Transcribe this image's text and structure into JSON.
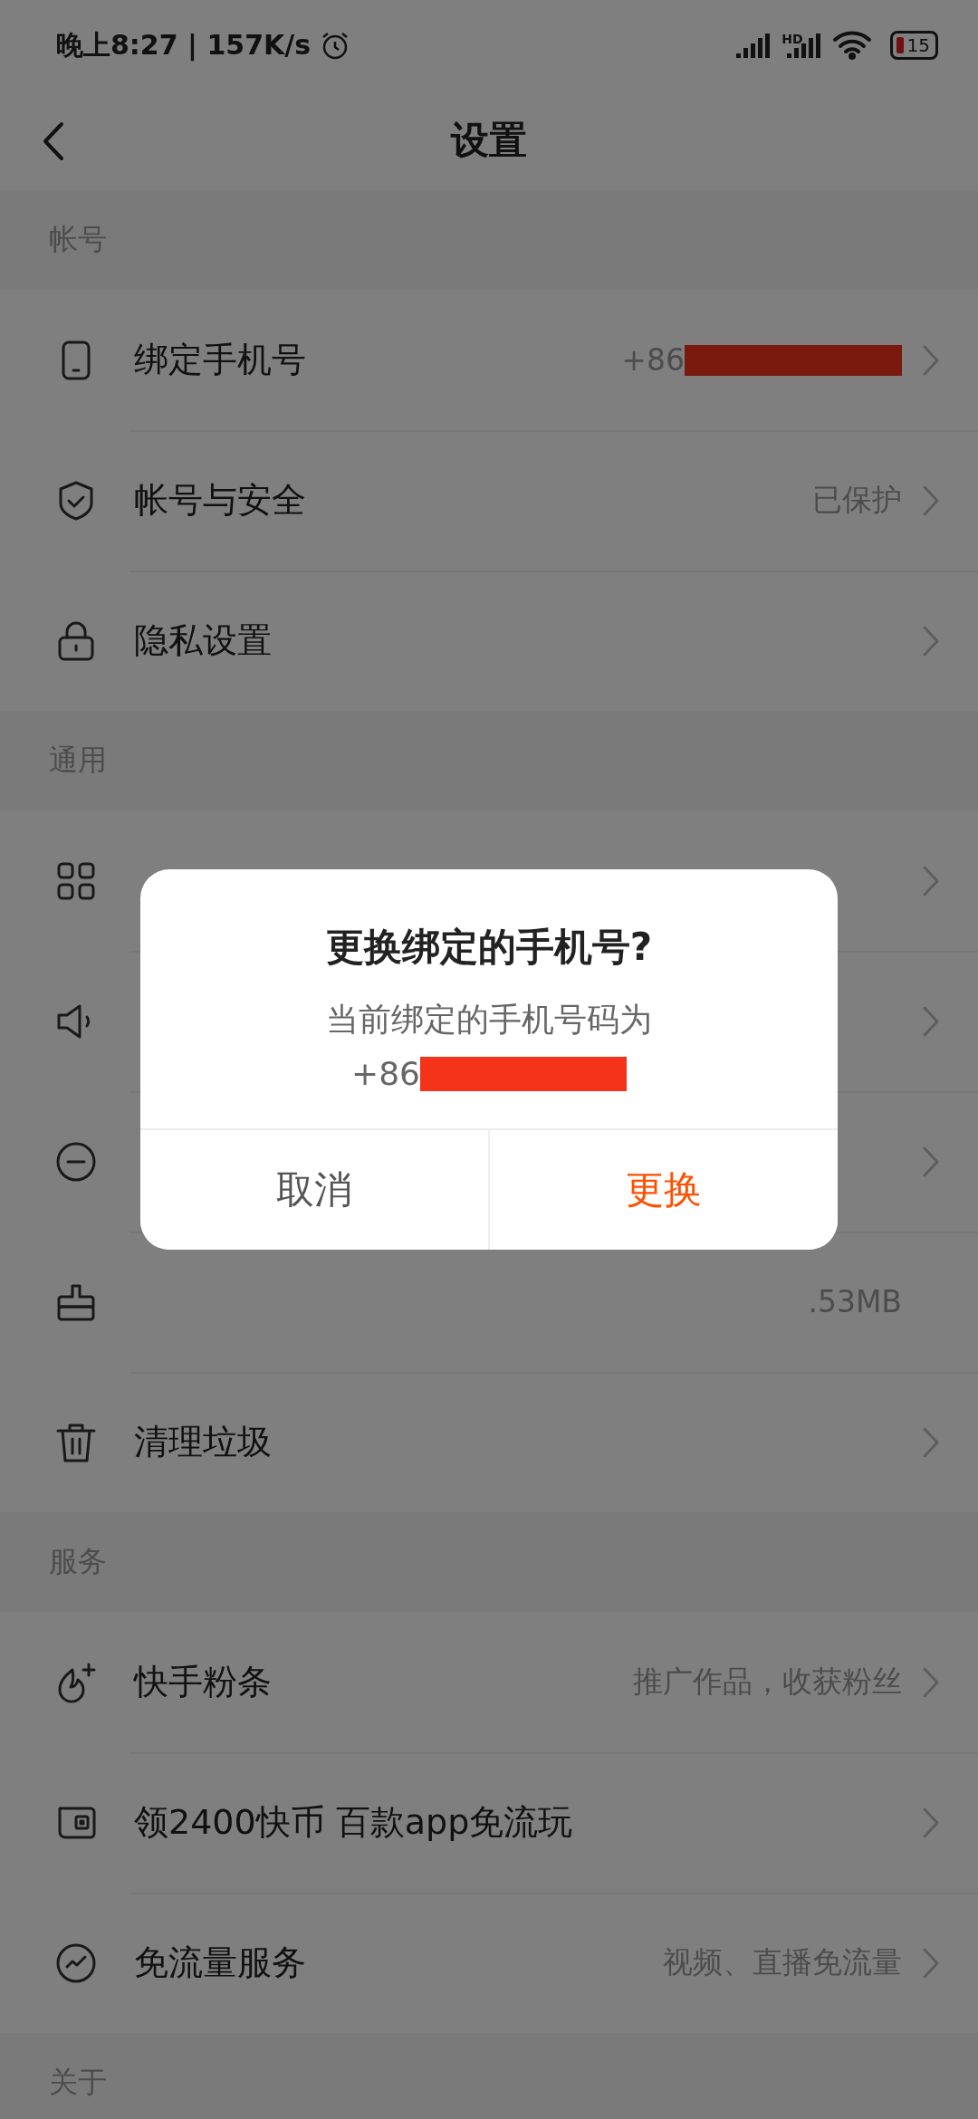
{
  "status_bar": {
    "time_speed": "晚上8:27 | 157K/s",
    "hd": "HD",
    "battery": "15"
  },
  "header": {
    "title": "设置"
  },
  "sections": [
    {
      "title": "帐号",
      "rows": [
        {
          "kind": "phone",
          "label": "绑定手机号",
          "value": "+86",
          "redacted": true,
          "chevron": true
        },
        {
          "kind": "shield",
          "label": "帐号与安全",
          "value": "已保护",
          "chevron": true
        },
        {
          "kind": "lock",
          "label": "隐私设置",
          "chevron": true
        }
      ]
    },
    {
      "title": "通用",
      "rows": [
        {
          "kind": "grid",
          "chevron": true
        },
        {
          "kind": "speaker",
          "chevron": true
        },
        {
          "kind": "minus",
          "chevron": true
        },
        {
          "kind": "brush",
          "value": ".53MB",
          "chevron": false
        },
        {
          "kind": "trash",
          "label": "清理垃圾",
          "chevron": true
        }
      ]
    },
    {
      "title": "服务",
      "rows": [
        {
          "kind": "flame",
          "label": "快手粉条",
          "value": "推广作品，收获粉丝",
          "chevron": true
        },
        {
          "kind": "ticket",
          "label": "领2400快币 百款app免流玩",
          "chevron": true
        },
        {
          "kind": "wave",
          "label": "免流量服务",
          "value": "视频、直播免流量",
          "chevron": true
        }
      ]
    },
    {
      "title": "关于"
    }
  ],
  "dialog": {
    "title": "更换绑定的手机号?",
    "message": "当前绑定的手机号码为",
    "number": "+86",
    "redacted": true,
    "buttons": [
      {
        "label": "取消",
        "kind": "cancel"
      },
      {
        "label": "更换",
        "kind": "confirm"
      }
    ]
  }
}
